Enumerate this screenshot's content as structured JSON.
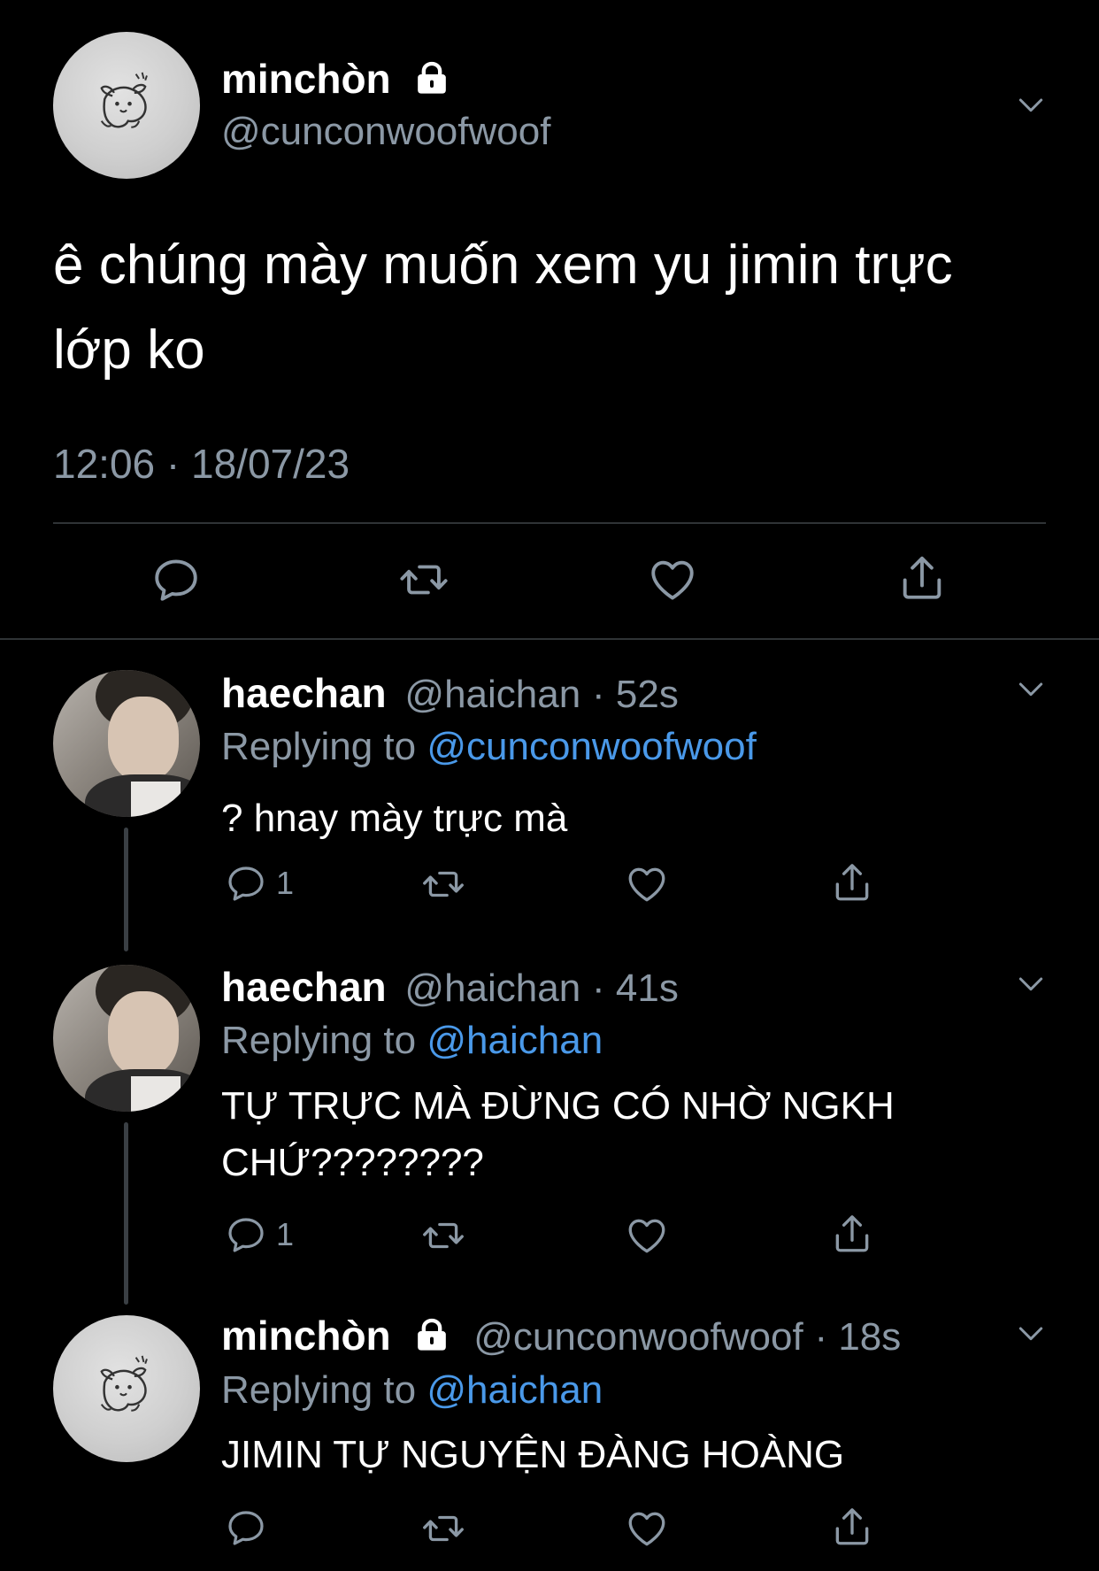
{
  "main_tweet": {
    "display_name": "minchòn",
    "handle": "@cunconwoofwoof",
    "text_line1": "ê chúng mày muốn xem yu jimin trực",
    "text_line2": "lớp ko",
    "timestamp": "12:06 · 18/07/23",
    "icons": [
      "lock-icon",
      "chevron-down-icon",
      "reply-icon",
      "retweet-icon",
      "like-icon",
      "share-icon"
    ]
  },
  "replies": [
    {
      "display_name": "haechan",
      "handle": "@haichan",
      "time": "· 52s",
      "replying_label": "Replying to",
      "replying_to": "@cunconwoofwoof",
      "text_line1": "? hnay mày trực mà",
      "text_line2": "",
      "reply_count": "1"
    },
    {
      "display_name": "haechan",
      "handle": "@haichan",
      "time": "· 41s",
      "replying_label": "Replying to",
      "replying_to": "@haichan",
      "text_line1": "TỰ TRỰC MÀ ĐỪNG CÓ NHỜ NGKH",
      "text_line2": "CHỨ????????",
      "reply_count": "1"
    },
    {
      "display_name": "minchòn",
      "handle": "@cunconwoofwoof",
      "time": "· 18s",
      "replying_label": "Replying to",
      "replying_to": "@haichan",
      "text_line1": "JIMIN TỰ NGUYỆN ĐÀNG HOÀNG",
      "text_line2": "",
      "reply_count": ""
    }
  ],
  "colors": {
    "background": "#000000",
    "muted": "#8b98a5",
    "link": "#4a99e9",
    "divider": "#2f3336"
  }
}
